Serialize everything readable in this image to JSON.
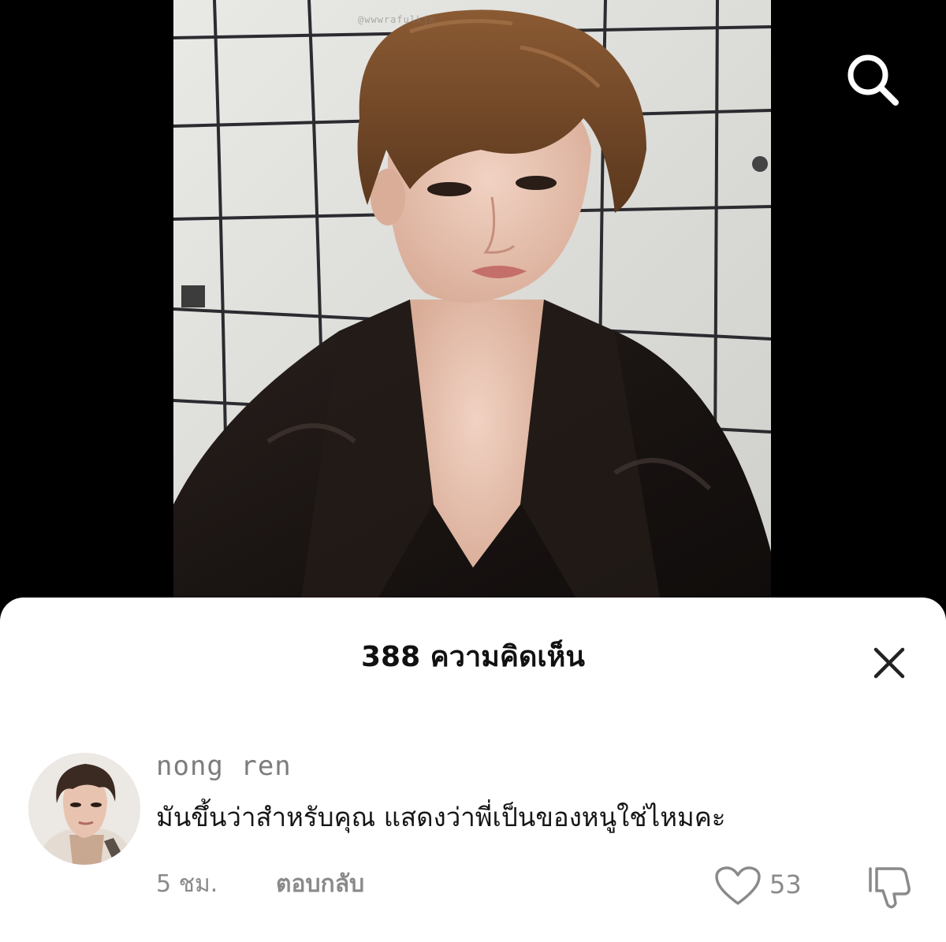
{
  "video": {
    "watermark": "@wwwrafulkjn",
    "search_icon": "search-icon"
  },
  "comments_sheet": {
    "title": "388 ความคิดเห็น",
    "close_icon": "close-icon",
    "comment": {
      "username": "nong ren",
      "text": "มันขึ้นว่าสำหรับคุณ แสดงว่าพี่เป็นของหนูใช่ไหมคะ",
      "time": "5 ชม.",
      "reply_label": "ตอบกลับ",
      "like_icon": "heart-icon",
      "like_count": "53",
      "dislike_icon": "thumbs-down-icon"
    }
  }
}
